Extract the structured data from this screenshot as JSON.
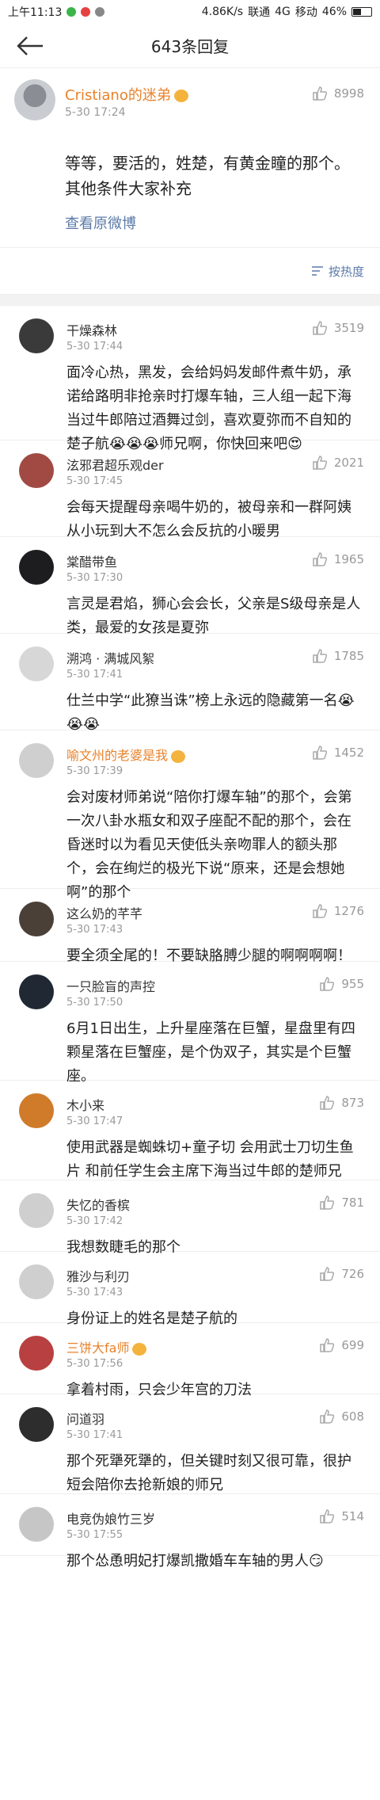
{
  "status": {
    "time": "上午11:13",
    "speed": "4.86K/s",
    "carrier1": "联通",
    "net": "4G",
    "carrier2": "移动",
    "battery": "46%"
  },
  "nav": {
    "title": "643条回复"
  },
  "original": {
    "user": "Cristiano的迷弟",
    "time": "5-30 17:24",
    "likes": "8998",
    "text": "等等，要活的，姓楚，有黄金瞳的那个。其他条件大家补充",
    "link": "查看原微博"
  },
  "sort": {
    "label": "按热度"
  },
  "comments": [
    {
      "user": "干燥森林",
      "time": "5-30 17:44",
      "likes": "3519",
      "text": "面冷心热，黑发，会给妈妈发邮件煮牛奶，承诺给路明非抢亲时打爆车轴，三人组一起下海当过牛郎陪过酒舞过剑，喜欢夏弥而不自知的楚子航😭😭😭师兄啊，你快回来吧😍"
    },
    {
      "user": "泫邪君超乐观der",
      "time": "5-30 17:45",
      "likes": "2021",
      "text": "会每天提醒母亲喝牛奶的，被母亲和一群阿姨从小玩到大不怎么会反抗的小暖男"
    },
    {
      "user": "棠醋带鱼",
      "time": "5-30 17:30",
      "likes": "1965",
      "text": "言灵是君焰，狮心会会长，父亲是S级母亲是人类，最爱的女孩是夏弥"
    },
    {
      "user": "溯鸿 · 满城风絮",
      "time": "5-30 17:41",
      "likes": "1785",
      "text": "仕兰中学“此獠当诛”榜上永远的隐藏第一名😭😭😭"
    },
    {
      "user": "喻文州的老婆是我",
      "time": "5-30 17:39",
      "likes": "1452",
      "text": "会对废材师弟说“陪你打爆车轴”的那个，会第一次八卦水瓶女和双子座配不配的那个，会在昏迷时以为看见天使低头亲吻罪人的额头那个，会在绚烂的极光下说“原来，还是会想她啊”的那个"
    },
    {
      "user": "这么奶的芊芊",
      "time": "5-30 17:43",
      "likes": "1276",
      "text": "要全须全尾的！不要缺胳膊少腿的啊啊啊啊！"
    },
    {
      "user": "一只脸盲的声控",
      "time": "5-30 17:50",
      "likes": "955",
      "text": "6月1日出生，上升星座落在巨蟹，星盘里有四颗星落在巨蟹座，是个伪双子，其实是个巨蟹座。"
    },
    {
      "user": "木小来",
      "time": "5-30 17:47",
      "likes": "873",
      "text": "使用武器是蜘蛛切+童子切  会用武士刀切生鱼片 和前任学生会主席下海当过牛郎的楚师兄"
    },
    {
      "user": "失忆的香槟",
      "time": "5-30 17:42",
      "likes": "781",
      "text": "我想数睫毛的那个"
    },
    {
      "user": "雅沙与利刃",
      "time": "5-30 17:43",
      "likes": "726",
      "text": "身份证上的姓名是楚子航的"
    },
    {
      "user": "三饼大fa师",
      "time": "5-30 17:56",
      "likes": "699",
      "text": "拿着村雨，只会少年宫的刀法"
    },
    {
      "user": "问道羽",
      "time": "5-30 17:41",
      "likes": "608",
      "text": "那个死犟死犟的，但关键时刻又很可靠，很护短会陪你去抢新娘的师兄"
    },
    {
      "user": "电竞伪娘竹三岁",
      "time": "5-30 17:55",
      "likes": "514",
      "text": "那个怂恿明妃打爆凯撒婚车车轴的男人😏"
    }
  ],
  "colors": {
    "accent": "#e8822b",
    "link": "#5b7aa8",
    "muted": "#999999"
  }
}
